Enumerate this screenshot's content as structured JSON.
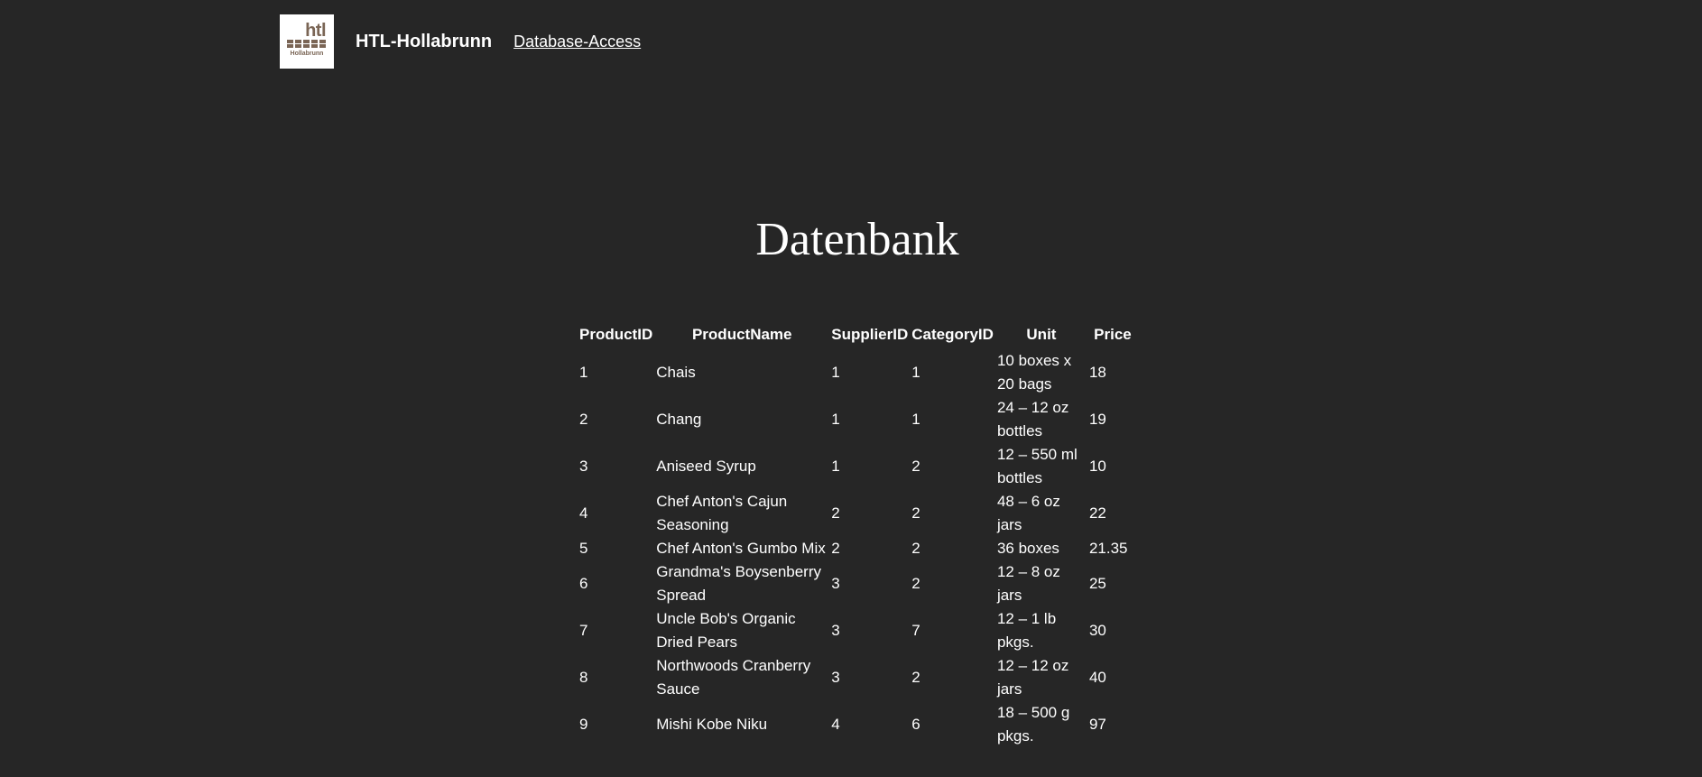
{
  "header": {
    "logo_text": "htl",
    "logo_subtext": "Hollabrunn",
    "brand": "HTL-Hollabrunn",
    "nav_link": "Database-Access"
  },
  "page": {
    "title": "Datenbank"
  },
  "table": {
    "columns": [
      "ProductID",
      "ProductName",
      "SupplierID",
      "CategoryID",
      "Unit",
      "Price"
    ],
    "rows": [
      {
        "id": "1",
        "name": "Chais",
        "supplier": "1",
        "category": "1",
        "unit": "10 boxes x 20 bags",
        "price": "18"
      },
      {
        "id": "2",
        "name": "Chang",
        "supplier": "1",
        "category": "1",
        "unit": "24 – 12 oz bottles",
        "price": "19"
      },
      {
        "id": "3",
        "name": "Aniseed Syrup",
        "supplier": "1",
        "category": "2",
        "unit": "12 – 550 ml bottles",
        "price": "10"
      },
      {
        "id": "4",
        "name": "Chef Anton's Cajun Seasoning",
        "supplier": "2",
        "category": "2",
        "unit": "48 – 6 oz jars",
        "price": "22"
      },
      {
        "id": "5",
        "name": "Chef Anton's Gumbo Mix",
        "supplier": "2",
        "category": "2",
        "unit": "36 boxes",
        "price": "21.35"
      },
      {
        "id": "6",
        "name": "Grandma's Boysenberry Spread",
        "supplier": "3",
        "category": "2",
        "unit": "12 – 8 oz jars",
        "price": "25"
      },
      {
        "id": "7",
        "name": "Uncle Bob's Organic Dried Pears",
        "supplier": "3",
        "category": "7",
        "unit": "12 – 1 lb pkgs.",
        "price": "30"
      },
      {
        "id": "8",
        "name": "Northwoods Cranberry Sauce",
        "supplier": "3",
        "category": "2",
        "unit": "12 – 12 oz jars",
        "price": "40"
      },
      {
        "id": "9",
        "name": "Mishi Kobe Niku",
        "supplier": "4",
        "category": "6",
        "unit": "18 – 500 g pkgs.",
        "price": "97"
      }
    ]
  }
}
